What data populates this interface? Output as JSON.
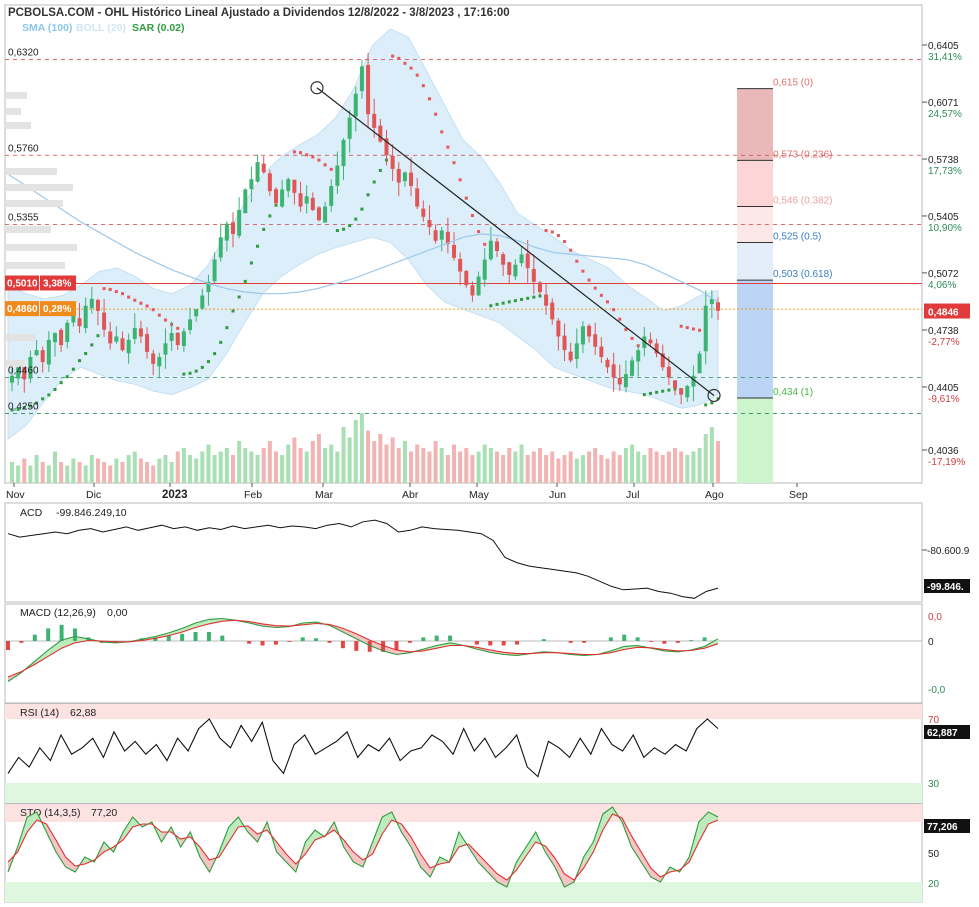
{
  "header": {
    "title": "PCBOLSA.COM - OHL Histórico Lineal Ajustado a Dividendos 12/8/2022 - 3/8/2023 , 17:16:00",
    "legend_sma": "SMA (100)",
    "legend_boll": "BOLL (20)",
    "legend_sar": "SAR (0.02)"
  },
  "colors": {
    "up": "#3cb371",
    "down": "#e05555",
    "sma": "#9cc8ea",
    "boll_fill": "#dbeefa",
    "grid_red": "#d04040",
    "grid_green": "#2e8b57",
    "fib_red": "#e07070",
    "fib_blue": "#3a7fc0",
    "fib_green": "#44b844"
  },
  "chart_data": [
    {
      "type": "candlestick",
      "name": "price",
      "x_labels": [
        "Nov",
        "Dic",
        "2023",
        "Feb",
        "Mar",
        "Abr",
        "May",
        "Jun",
        "Jul",
        "Ago",
        "Sep"
      ],
      "ylim": [
        0.39,
        0.66
      ],
      "right_ticks": [
        {
          "value": 0.6405,
          "text": "0,6405",
          "pct": "31,41%"
        },
        {
          "value": 0.6071,
          "text": "0,6071",
          "pct": "24,57%"
        },
        {
          "value": 0.5738,
          "text": "0,5738",
          "pct": "17,73%"
        },
        {
          "value": 0.5405,
          "text": "0,5405",
          "pct": "10,90%"
        },
        {
          "value": 0.5072,
          "text": "0,5072",
          "pct": "4,06%"
        },
        {
          "value": 0.4738,
          "text": "0,4738",
          "pct": "-2,77%"
        },
        {
          "value": 0.4405,
          "text": "0,4405",
          "pct": "-9,61%"
        },
        {
          "value": 0.4036,
          "text": "0,4036",
          "pct": "-17,19%"
        }
      ],
      "left_levels": [
        {
          "value": 0.632,
          "text": "0,6320"
        },
        {
          "value": 0.576,
          "text": "0,5760"
        },
        {
          "value": 0.5355,
          "text": "0,5355"
        },
        {
          "value": 0.446,
          "text": "0,4460"
        },
        {
          "value": 0.425,
          "text": "0,4250"
        }
      ],
      "marker_red": {
        "value": 0.501,
        "text": "0,5010",
        "pct": "3,38%"
      },
      "marker_orange": {
        "value": 0.486,
        "text": "0,4860",
        "pct": "0,28%"
      },
      "last_price": {
        "value": 0.4846,
        "text": "0,4846"
      },
      "fibonacci": [
        {
          "value": 0.615,
          "text": "0,615 (0)"
        },
        {
          "value": 0.573,
          "text": "0,573 (0.236)"
        },
        {
          "value": 0.546,
          "text": "0,546 (0.382)"
        },
        {
          "value": 0.525,
          "text": "0,525 (0.5)"
        },
        {
          "value": 0.503,
          "text": "0,503 (0.618)"
        },
        {
          "value": 0.434,
          "text": "0,434 (1)"
        }
      ],
      "trendline": {
        "from": {
          "date": "2023-02-28",
          "value": 0.6155
        },
        "to": {
          "date": "2023-08-01",
          "value": 0.4355
        }
      },
      "closes": [
        0.447,
        0.452,
        0.445,
        0.458,
        0.462,
        0.455,
        0.468,
        0.472,
        0.465,
        0.478,
        0.482,
        0.476,
        0.488,
        0.492,
        0.485,
        0.474,
        0.466,
        0.47,
        0.462,
        0.468,
        0.475,
        0.47,
        0.461,
        0.454,
        0.458,
        0.466,
        0.472,
        0.465,
        0.473,
        0.48,
        0.486,
        0.494,
        0.502,
        0.515,
        0.528,
        0.536,
        0.53,
        0.544,
        0.556,
        0.562,
        0.572,
        0.566,
        0.555,
        0.548,
        0.556,
        0.562,
        0.554,
        0.546,
        0.552,
        0.544,
        0.538,
        0.546,
        0.558,
        0.57,
        0.585,
        0.598,
        0.612,
        0.628,
        0.6,
        0.592,
        0.584,
        0.576,
        0.568,
        0.56,
        0.566,
        0.558,
        0.546,
        0.54,
        0.534,
        0.526,
        0.532,
        0.524,
        0.516,
        0.508,
        0.5,
        0.494,
        0.505,
        0.515,
        0.526,
        0.52,
        0.512,
        0.506,
        0.512,
        0.518,
        0.51,
        0.502,
        0.496,
        0.488,
        0.48,
        0.47,
        0.462,
        0.456,
        0.466,
        0.476,
        0.47,
        0.464,
        0.458,
        0.452,
        0.446,
        0.442,
        0.448,
        0.456,
        0.462,
        0.47,
        0.466,
        0.46,
        0.452,
        0.446,
        0.44,
        0.436,
        0.441,
        0.447,
        0.46,
        0.488,
        0.492,
        0.485
      ],
      "sma_100": [
        0.565,
        0.558,
        0.551,
        0.544,
        0.537,
        0.531,
        0.525,
        0.519,
        0.514,
        0.509,
        0.505,
        0.501,
        0.498,
        0.496,
        0.495,
        0.495,
        0.496,
        0.498,
        0.501,
        0.504,
        0.508,
        0.512,
        0.516,
        0.52,
        0.524,
        0.528,
        0.53,
        0.529,
        0.526,
        0.522,
        0.519,
        0.518,
        0.517,
        0.516,
        0.515,
        0.512,
        0.507,
        0.502,
        0.497,
        0.49
      ],
      "bollinger_upper": [
        0.5,
        0.495,
        0.492,
        0.494,
        0.5,
        0.508,
        0.51,
        0.505,
        0.498,
        0.495,
        0.5,
        0.512,
        0.53,
        0.548,
        0.565,
        0.575,
        0.582,
        0.588,
        0.598,
        0.615,
        0.64,
        0.65,
        0.645,
        0.625,
        0.605,
        0.585,
        0.575,
        0.56,
        0.542,
        0.535,
        0.528,
        0.52,
        0.515,
        0.51,
        0.5,
        0.493,
        0.485,
        0.488,
        0.494,
        0.497
      ],
      "bollinger_lower": [
        0.41,
        0.418,
        0.432,
        0.445,
        0.452,
        0.448,
        0.444,
        0.442,
        0.438,
        0.436,
        0.44,
        0.445,
        0.46,
        0.478,
        0.495,
        0.505,
        0.512,
        0.518,
        0.522,
        0.525,
        0.528,
        0.525,
        0.515,
        0.5,
        0.49,
        0.486,
        0.482,
        0.478,
        0.47,
        0.462,
        0.452,
        0.448,
        0.444,
        0.44,
        0.438,
        0.436,
        0.432,
        0.428,
        0.43,
        0.436
      ],
      "volume": [
        6,
        5,
        7,
        5,
        8,
        6,
        5,
        9,
        6,
        5,
        7,
        6,
        5,
        8,
        7,
        6,
        5,
        7,
        6,
        8,
        9,
        7,
        6,
        5,
        7,
        8,
        6,
        9,
        10,
        8,
        7,
        9,
        11,
        8,
        9,
        10,
        8,
        12,
        10,
        9,
        8,
        10,
        12,
        9,
        8,
        11,
        13,
        10,
        9,
        12,
        14,
        10,
        11,
        9,
        16,
        13,
        18,
        20,
        15,
        12,
        14,
        11,
        13,
        10,
        12,
        9,
        11,
        10,
        9,
        12,
        10,
        8,
        11,
        9,
        10,
        8,
        9,
        11,
        10,
        9,
        8,
        10,
        9,
        11,
        8,
        9,
        10,
        8,
        9,
        7,
        8,
        9,
        7,
        8,
        9,
        10,
        8,
        7,
        9,
        8,
        10,
        11,
        9,
        8,
        10,
        9,
        8,
        9,
        10,
        9,
        8,
        9,
        10,
        14,
        16,
        12
      ]
    },
    {
      "type": "line",
      "name": "ACD",
      "title": "ACD",
      "value_text": "-99.846.249,10",
      "right_ticks": [
        "-80.600.9",
        "-99.846."
      ],
      "values": [
        0.78,
        0.74,
        0.76,
        0.78,
        0.8,
        0.78,
        0.82,
        0.84,
        0.8,
        0.83,
        0.86,
        0.82,
        0.85,
        0.88,
        0.84,
        0.86,
        0.82,
        0.85,
        0.83,
        0.87,
        0.84,
        0.86,
        0.88,
        0.85,
        0.87,
        0.86,
        0.84,
        0.88,
        0.9,
        0.86,
        0.92,
        0.94,
        0.9,
        0.8,
        0.82,
        0.86,
        0.84,
        0.83,
        0.82,
        0.8,
        0.78,
        0.7,
        0.5,
        0.44,
        0.4,
        0.38,
        0.36,
        0.34,
        0.32,
        0.28,
        0.22,
        0.16,
        0.12,
        0.13,
        0.14,
        0.1,
        0.08,
        0.04,
        0.02,
        0.1,
        0.14
      ]
    },
    {
      "type": "line",
      "name": "MACD",
      "title": "MACD (12,26,9)",
      "value_text": "0,00",
      "right_ticks": [
        "0,0",
        "0",
        "-0,0"
      ],
      "macd": [
        -0.9,
        -0.7,
        -0.45,
        -0.2,
        0.02,
        0.1,
        0.05,
        -0.02,
        -0.04,
        -0.02,
        0.04,
        0.1,
        0.18,
        0.28,
        0.4,
        0.48,
        0.5,
        0.46,
        0.4,
        0.33,
        0.3,
        0.32,
        0.4,
        0.42,
        0.35,
        0.2,
        0.05,
        -0.1,
        -0.22,
        -0.3,
        -0.26,
        -0.18,
        -0.1,
        -0.04,
        -0.1,
        -0.18,
        -0.25,
        -0.3,
        -0.32,
        -0.28,
        -0.24,
        -0.26,
        -0.3,
        -0.32,
        -0.3,
        -0.22,
        -0.12,
        -0.1,
        -0.16,
        -0.22,
        -0.24,
        -0.2,
        -0.12,
        0.05
      ],
      "signal": [
        -0.8,
        -0.68,
        -0.52,
        -0.34,
        -0.16,
        -0.04,
        0.01,
        0.0,
        -0.02,
        -0.02,
        0.01,
        0.06,
        0.12,
        0.2,
        0.3,
        0.38,
        0.44,
        0.46,
        0.43,
        0.38,
        0.34,
        0.33,
        0.36,
        0.39,
        0.37,
        0.28,
        0.16,
        0.02,
        -0.1,
        -0.2,
        -0.24,
        -0.22,
        -0.16,
        -0.1,
        -0.1,
        -0.14,
        -0.2,
        -0.25,
        -0.28,
        -0.28,
        -0.26,
        -0.26,
        -0.28,
        -0.3,
        -0.3,
        -0.26,
        -0.19,
        -0.14,
        -0.15,
        -0.19,
        -0.22,
        -0.21,
        -0.16,
        -0.06
      ]
    },
    {
      "type": "line",
      "name": "RSI",
      "title": "RSI (14)",
      "value_text": "62,88",
      "right_ticks": [
        "70",
        "62,887",
        "30"
      ],
      "ylim": [
        15,
        75
      ],
      "values": [
        36,
        46,
        40,
        52,
        44,
        60,
        48,
        52,
        58,
        46,
        62,
        50,
        56,
        48,
        54,
        44,
        58,
        50,
        64,
        70,
        58,
        52,
        66,
        56,
        68,
        44,
        36,
        54,
        60,
        48,
        52,
        56,
        62,
        46,
        54,
        50,
        58,
        44,
        50,
        52,
        60,
        56,
        48,
        64,
        50,
        58,
        46,
        52,
        60,
        40,
        34,
        56,
        52,
        46,
        58,
        48,
        64,
        54,
        50,
        60,
        46,
        52,
        48,
        54,
        50,
        64,
        70,
        64
      ],
      "levels": [
        70,
        30
      ]
    },
    {
      "type": "line",
      "name": "STO",
      "title": "STO (14,3,5)",
      "value_text": "77,20",
      "right_ticks": [
        "77,206",
        "50",
        "20"
      ],
      "ylim": [
        0,
        100
      ],
      "k": [
        30,
        55,
        85,
        90,
        70,
        50,
        35,
        30,
        45,
        40,
        60,
        50,
        70,
        85,
        75,
        80,
        60,
        75,
        55,
        70,
        45,
        30,
        50,
        75,
        85,
        70,
        60,
        80,
        50,
        40,
        30,
        60,
        72,
        65,
        80,
        55,
        40,
        35,
        60,
        85,
        90,
        70,
        55,
        35,
        25,
        45,
        40,
        70,
        55,
        40,
        30,
        20,
        15,
        40,
        55,
        70,
        50,
        35,
        15,
        20,
        45,
        60,
        88,
        95,
        80,
        55,
        40,
        25,
        20,
        35,
        30,
        45,
        80,
        90,
        85
      ],
      "d": [
        40,
        50,
        70,
        82,
        78,
        62,
        45,
        36,
        38,
        42,
        50,
        55,
        62,
        75,
        78,
        78,
        70,
        70,
        63,
        65,
        55,
        42,
        45,
        60,
        75,
        76,
        68,
        72,
        60,
        48,
        38,
        48,
        62,
        66,
        72,
        62,
        50,
        42,
        48,
        68,
        82,
        78,
        65,
        48,
        34,
        38,
        40,
        55,
        58,
        48,
        38,
        28,
        22,
        32,
        46,
        60,
        56,
        44,
        28,
        22,
        34,
        50,
        72,
        88,
        84,
        66,
        50,
        34,
        25,
        30,
        32,
        40,
        60,
        78,
        82
      ],
      "levels": [
        80,
        20
      ]
    }
  ]
}
